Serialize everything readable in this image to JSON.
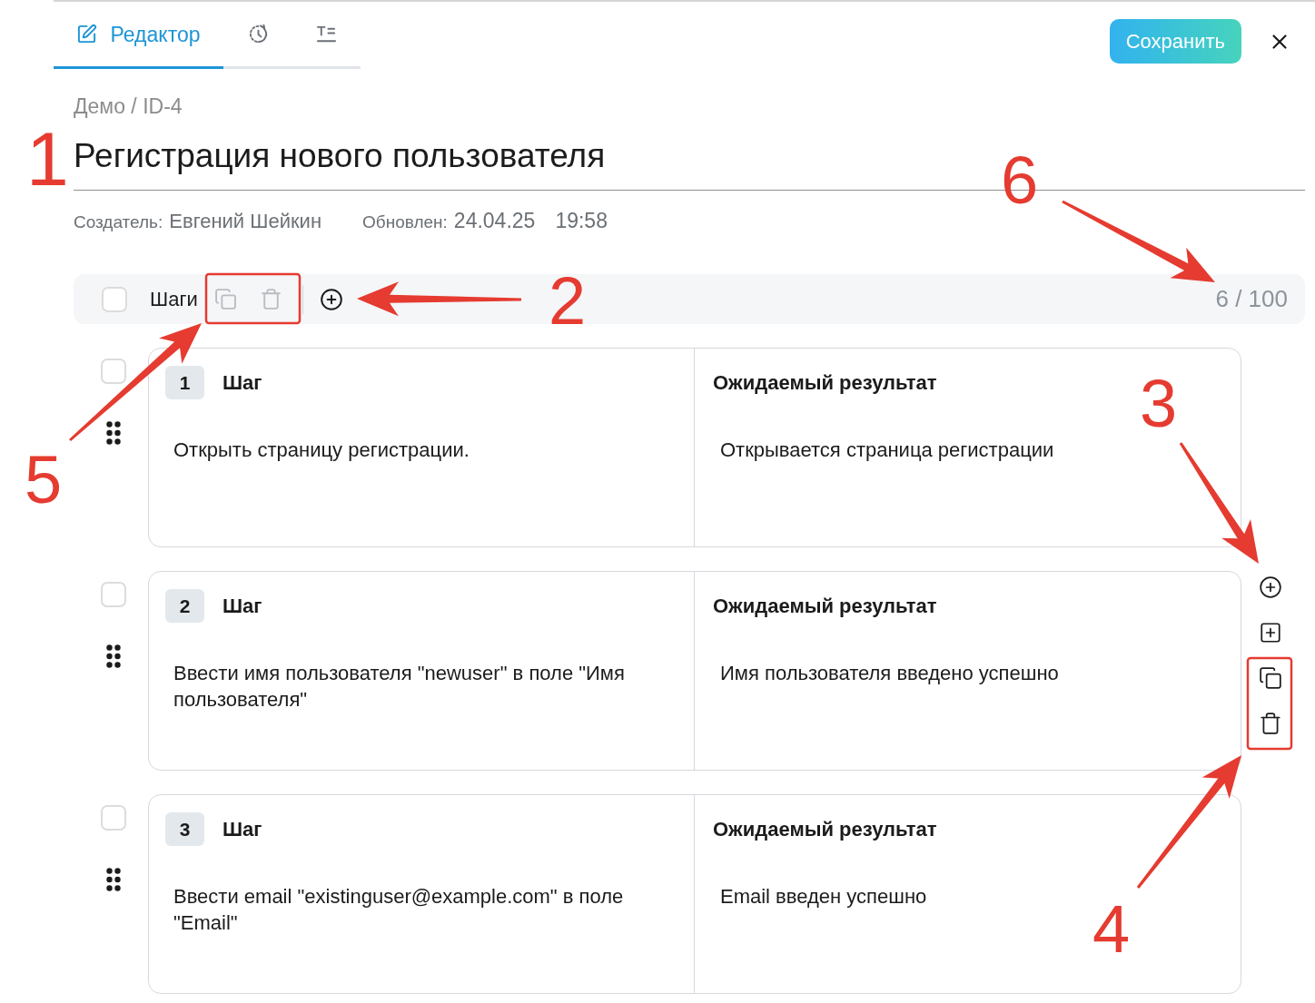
{
  "tabs": [
    {
      "kind": "editor",
      "label": "Редактор",
      "selected": true
    },
    {
      "kind": "history",
      "selected": false
    },
    {
      "kind": "format",
      "selected": false
    }
  ],
  "save_button": "Сохранить",
  "breadcrumb": "Демо / ID-4",
  "title": "Регистрация нового пользователя",
  "meta": {
    "creator_label": "Создатель:",
    "creator": "Евгений Шейкин",
    "updated_label": "Обновлен:",
    "updated_date": "24.04.25",
    "updated_time": "19:58"
  },
  "steps_toolbar": {
    "checked": false,
    "label": "Шаги",
    "bulk_actions": [
      {
        "kind": "copy",
        "disabled": true
      },
      {
        "kind": "delete",
        "disabled": true
      }
    ],
    "add_step": {
      "disabled": false
    },
    "count": "6 / 100"
  },
  "steps": [
    {
      "number": "1",
      "step_label": "Шаг",
      "action": "Открыть страницу регистрации.",
      "result_label": "Ожидаемый результат",
      "result": "Открывается страница регистрации",
      "checked": false,
      "hovered": false
    },
    {
      "number": "2",
      "step_label": "Шаг",
      "action": "Ввести имя пользователя \"newuser\" в поле \"Имя пользователя\"",
      "result_label": "Ожидаемый результат",
      "result": "Имя пользователя введено успешно",
      "checked": false,
      "hovered": true
    },
    {
      "number": "3",
      "step_label": "Шаг",
      "action": "Ввести email \"existinguser@example.com\" в поле \"Email\"",
      "result_label": "Ожидаемый результат",
      "result": "Email введен успешно",
      "checked": false,
      "hovered": false
    }
  ],
  "annotations": {
    "numbers": [
      "1",
      "2",
      "3",
      "4",
      "5",
      "6"
    ]
  }
}
